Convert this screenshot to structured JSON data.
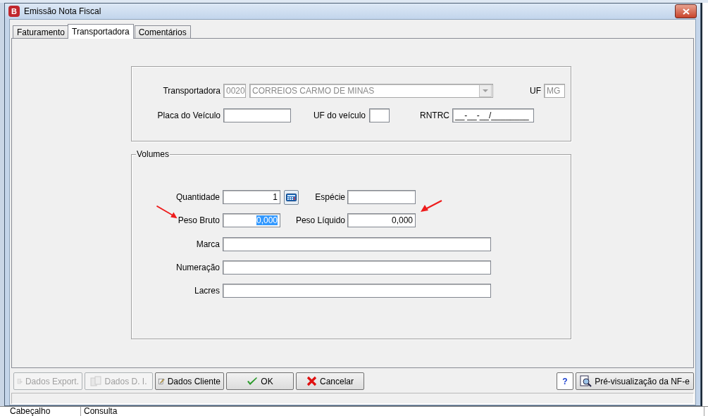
{
  "window": {
    "logo": "B",
    "title": "Emissão Nota Fiscal"
  },
  "tabs": [
    {
      "label": "Faturamento",
      "selected": false
    },
    {
      "label": "Transportadora",
      "selected": true
    },
    {
      "label": "Comentários",
      "selected": false
    }
  ],
  "transportadora": {
    "label": "Transportadora",
    "code": "0020",
    "name": "CORREIOS CARMO DE MINAS",
    "uf_label": "UF",
    "uf": "MG",
    "disabled": true,
    "placa_label": "Placa do Veículo",
    "uf_veiculo_label": "UF do veículo",
    "rntrc_label": "RNTRC",
    "rntrc_mask": "__-__-__/________"
  },
  "volumes": {
    "title": "Volumes",
    "fields": [
      {
        "label": "Quantidade",
        "value": "1",
        "kind": "number",
        "selected": false
      },
      {
        "label": "Espécie",
        "kind": "text",
        "selected": false
      },
      {
        "label": "Peso Bruto",
        "value": "0,000",
        "kind": "number",
        "selected": true
      },
      {
        "label": "Peso Líquido",
        "value": "0,000",
        "kind": "number",
        "selected": false
      },
      {
        "label": "Marca",
        "kind": "wide",
        "selected": false
      },
      {
        "label": "Numeração",
        "kind": "wide",
        "selected": false
      },
      {
        "label": "Lacres",
        "kind": "wide",
        "selected": false
      }
    ]
  },
  "buttons": [
    {
      "label": "Dados Export.",
      "kind": "export",
      "disabled": true
    },
    {
      "label": "Dados D. I.",
      "kind": "import",
      "disabled": true
    },
    {
      "label": "Dados Cliente",
      "kind": "edit",
      "disabled": false
    },
    {
      "label": "OK",
      "kind": "ok",
      "disabled": false
    },
    {
      "label": "Cancelar",
      "kind": "cancel",
      "disabled": false
    },
    {
      "label": "?",
      "kind": "help",
      "disabled": false
    },
    {
      "label": "Pré-visualização da NF-e",
      "kind": "preview",
      "disabled": false
    }
  ],
  "background_window": {
    "cells": [
      "Cabeçalho",
      "Consulta"
    ]
  }
}
